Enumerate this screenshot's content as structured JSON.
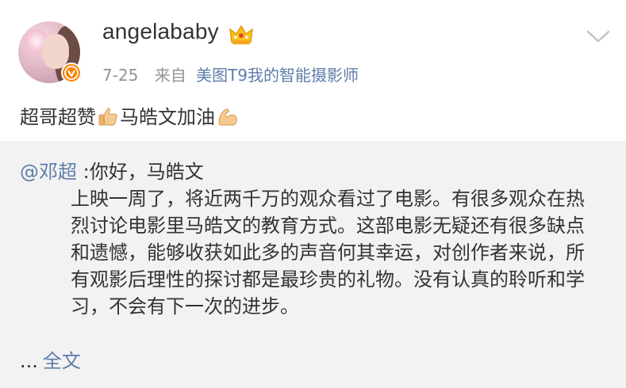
{
  "post": {
    "username": "angelababy",
    "time": "7-25",
    "from_label": "来自",
    "source": "美图T9我的智能摄影师",
    "text_part1": "超哥超赞",
    "text_part2": "马皓文加油"
  },
  "repost": {
    "mention": "@邓超",
    "greeting": " :你好，马皓文",
    "body": "上映一周了，将近两千万的观众看过了电影。有很多观众在热烈讨论电影里马皓文的教育方式。这部电影无疑还有很多缺点和遗憾，能够收获如此多的声音何其幸运，对创作者来说，所有观影后理性的探讨都是最珍贵的礼物。没有认真的聆听和学习，不会有下一次的进步。",
    "ellipsis": "...",
    "full_text_link": "全文"
  },
  "icons": {
    "badge": "verified-v-badge",
    "crown": "crown-icon",
    "menu": "chevron-down-icon",
    "emoji1": "thumbs-up-emoji",
    "emoji2": "flexed-biceps-emoji"
  },
  "colors": {
    "link": "#5e7dab",
    "meta": "#939393",
    "badge": "#ff8200",
    "repost_bg": "#f2f2f2"
  }
}
